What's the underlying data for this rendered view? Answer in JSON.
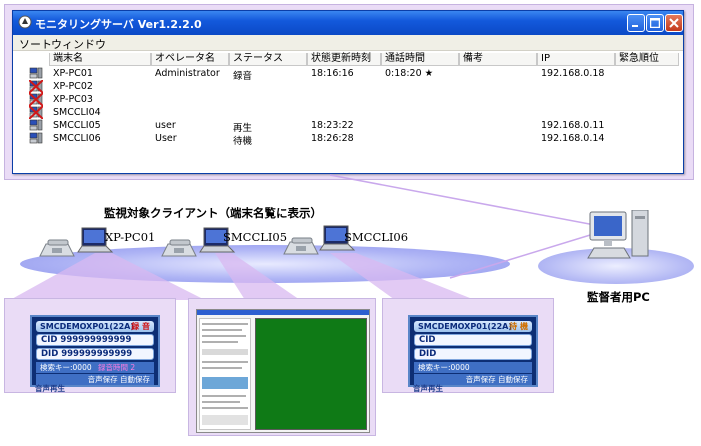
{
  "window": {
    "title": "モニタリングサーバ Ver1.2.2.0",
    "menu": [
      "ソート",
      "ウィンドウ"
    ],
    "columns": [
      "端末名",
      "オペレータ名",
      "ステータス",
      "状態更新時刻",
      "通話時間",
      "備考",
      "IP",
      "緊急順位"
    ],
    "rows": [
      {
        "terminal": "XP-PC01",
        "operator": "Administrator",
        "status": "録音",
        "updated": "18:16:16",
        "duration": "0:18:20 ★",
        "note": "",
        "ip": "192.168.0.18",
        "priority": "",
        "state": "ok"
      },
      {
        "terminal": "XP-PC02",
        "operator": "",
        "status": "",
        "updated": "",
        "duration": "",
        "note": "",
        "ip": "",
        "priority": "",
        "state": "offline"
      },
      {
        "terminal": "XP-PC03",
        "operator": "",
        "status": "",
        "updated": "",
        "duration": "",
        "note": "",
        "ip": "",
        "priority": "",
        "state": "offline"
      },
      {
        "terminal": "SMCCLI04",
        "operator": "",
        "status": "",
        "updated": "",
        "duration": "",
        "note": "",
        "ip": "",
        "priority": "",
        "state": "offline"
      },
      {
        "terminal": "SMCCLI05",
        "operator": "user",
        "status": "再生",
        "updated": "18:23:22",
        "duration": "",
        "note": "",
        "ip": "192.168.0.11",
        "priority": "",
        "state": "ok"
      },
      {
        "terminal": "SMCCLI06",
        "operator": "User",
        "status": "待機",
        "updated": "18:26:28",
        "duration": "",
        "note": "",
        "ip": "192.168.0.14",
        "priority": "",
        "state": "ok"
      }
    ]
  },
  "network": {
    "label": "監視対象クライアント（端末名覧に表示）",
    "terminals": [
      "XP-PC01",
      "SMCCLI05",
      "SMCCLI06"
    ]
  },
  "admin_pc": {
    "label": "監督者用PC"
  },
  "panels": {
    "left": {
      "header": "SMCDEMOXP01(22A)",
      "status": "録 音",
      "cid": "CID 999999999999",
      "did": "DID 999999999999",
      "search": "検索キー:0000",
      "rec_time": "録音時間 2",
      "save": "音声保存 自動保存",
      "play": "音声再生"
    },
    "right": {
      "header": "SMCDEMOXP01(22A)",
      "status": "待 機",
      "cid": "CID",
      "did": "DID",
      "search": "検索キー:0000",
      "save": "音声保存 自動保存",
      "play": "音声再生"
    }
  },
  "colors": {
    "titlebar": "#1359dc",
    "frame": "#eadcf6",
    "network": "#aeb4f5",
    "green_screen": "#0f7a16"
  }
}
